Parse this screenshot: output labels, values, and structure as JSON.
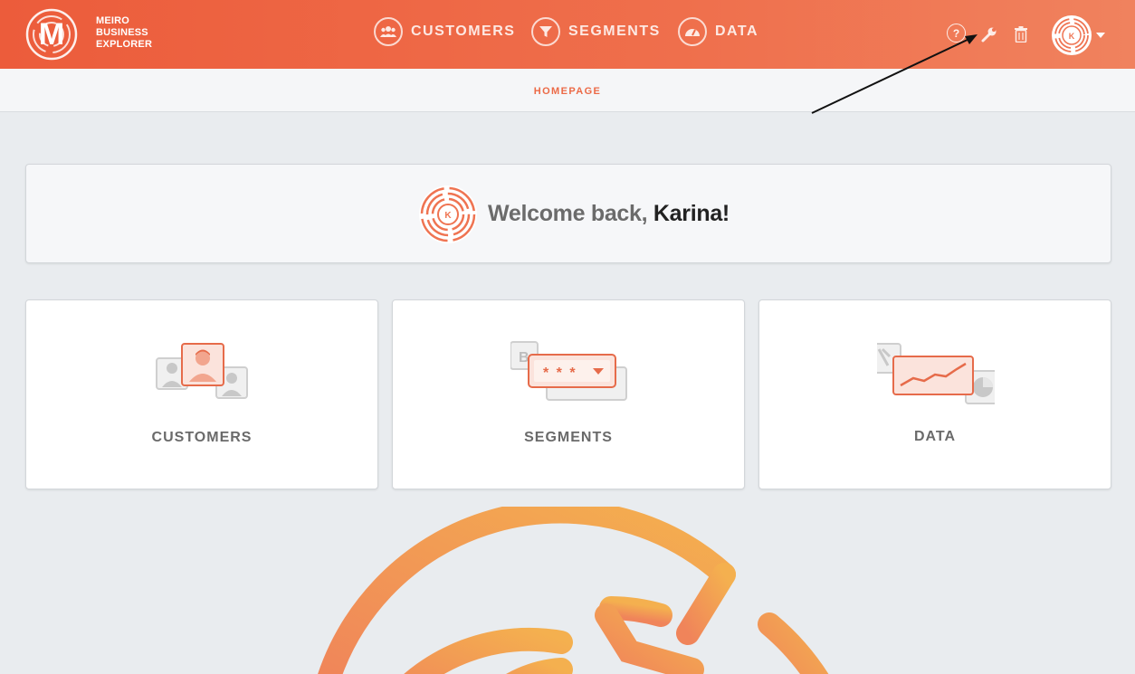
{
  "app": {
    "logo_letter": "M",
    "logo_lines": [
      "MEIRO",
      "BUSINESS",
      "EXPLORER"
    ]
  },
  "nav": [
    {
      "label": "CUSTOMERS",
      "icon": "users-icon"
    },
    {
      "label": "SEGMENTS",
      "icon": "filter-icon"
    },
    {
      "label": "DATA",
      "icon": "dashboard-gauge-icon"
    }
  ],
  "top_icons": {
    "help": "?",
    "settings": "wrench-icon",
    "trash": "trash-icon",
    "avatar_initial": "K"
  },
  "breadcrumb": "HOMEPAGE",
  "welcome": {
    "prefix": "Welcome back, ",
    "name": "Karina!",
    "avatar_initial": "K"
  },
  "cards": [
    {
      "label": "CUSTOMERS"
    },
    {
      "label": "SEGMENTS"
    },
    {
      "label": "DATA"
    }
  ],
  "segments_illustration": {
    "stars": "* * *",
    "letter": "B"
  },
  "colors": {
    "brand_orange": "#ec5c3b",
    "accent": "#ec6a47",
    "maze_gradient_start": "#f0845a",
    "maze_gradient_end": "#f4b04f"
  }
}
